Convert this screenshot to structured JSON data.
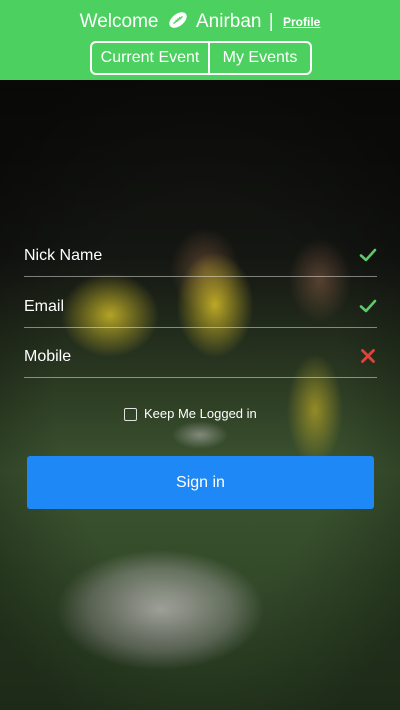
{
  "header": {
    "welcome_text": "Welcome",
    "user_name": "Anirban",
    "separator": "|",
    "profile_link": "Profile",
    "tabs": [
      {
        "label": "Current Event"
      },
      {
        "label": "My Events"
      }
    ],
    "background_color": "#4cd160"
  },
  "form": {
    "fields": [
      {
        "label": "Nick Name",
        "status": "valid",
        "status_icon": "check-icon"
      },
      {
        "label": "Email",
        "status": "valid",
        "status_icon": "check-icon"
      },
      {
        "label": "Mobile",
        "status": "invalid",
        "status_icon": "cross-icon"
      }
    ],
    "remember_me": {
      "label": "Keep Me Logged in",
      "checked": false
    },
    "submit_label": "Sign in"
  },
  "colors": {
    "accent_green": "#4cd160",
    "valid_check": "#5fc86a",
    "invalid_cross": "#e0433b",
    "button_blue": "#1e88f6"
  }
}
